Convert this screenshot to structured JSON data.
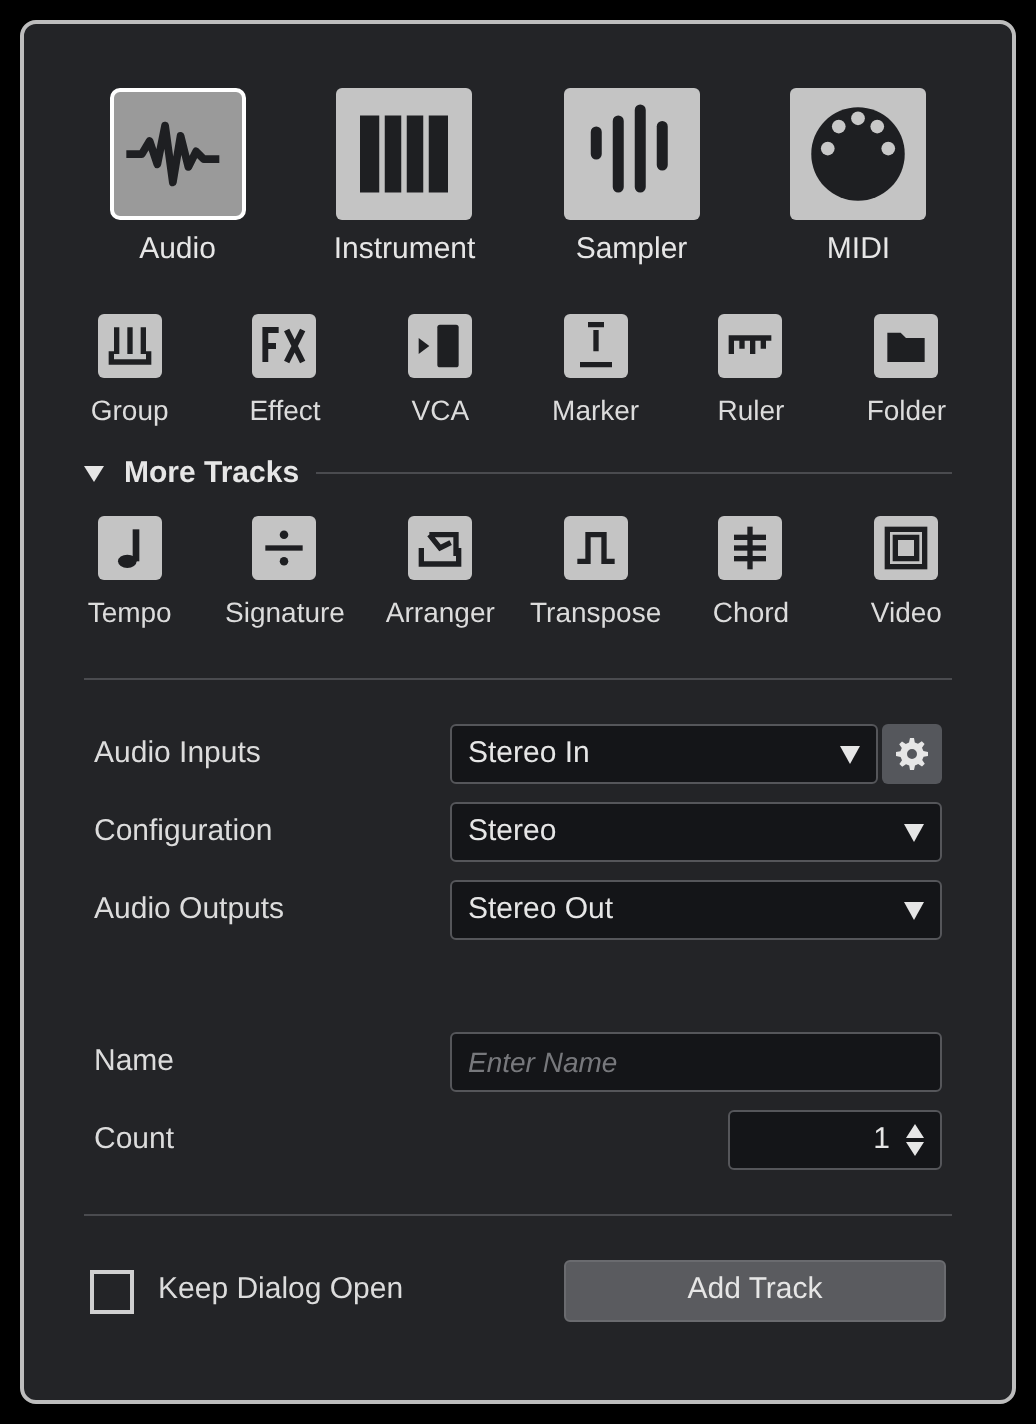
{
  "main_tracks": [
    {
      "label": "Audio",
      "selected": true
    },
    {
      "label": "Instrument",
      "selected": false
    },
    {
      "label": "Sampler",
      "selected": false
    },
    {
      "label": "MIDI",
      "selected": false
    }
  ],
  "tracks": [
    {
      "label": "Group"
    },
    {
      "label": "Effect"
    },
    {
      "label": "VCA"
    },
    {
      "label": "Marker"
    },
    {
      "label": "Ruler"
    },
    {
      "label": "Folder"
    }
  ],
  "more_tracks": {
    "title": "More Tracks",
    "expanded": true,
    "items": [
      {
        "label": "Tempo"
      },
      {
        "label": "Signature"
      },
      {
        "label": "Arranger"
      },
      {
        "label": "Transpose"
      },
      {
        "label": "Chord"
      },
      {
        "label": "Video"
      }
    ]
  },
  "routing": [
    {
      "label": "Audio Inputs",
      "value": "Stereo In",
      "settings": true
    },
    {
      "label": "Configuration",
      "value": "Stereo",
      "settings": false
    },
    {
      "label": "Audio Outputs",
      "value": "Stereo Out",
      "settings": false
    }
  ],
  "name": {
    "label": "Name",
    "placeholder": "Enter Name"
  },
  "count": {
    "label": "Count",
    "value": "1"
  },
  "keep_open": {
    "label": "Keep Dialog Open",
    "checked": false
  },
  "add_button": "Add Track"
}
